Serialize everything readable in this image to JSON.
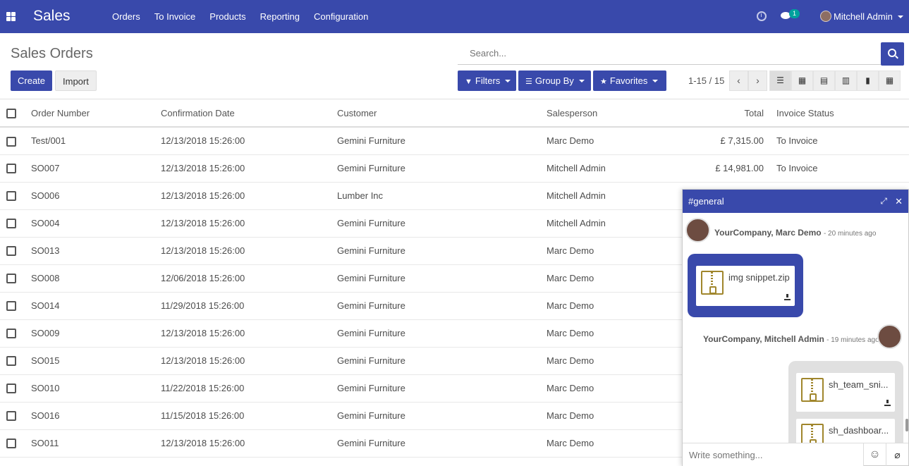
{
  "app": {
    "brand": "Sales",
    "menu": [
      "Orders",
      "To Invoice",
      "Products",
      "Reporting",
      "Configuration"
    ],
    "chat_badge": "1",
    "user_name": "Mitchell Admin"
  },
  "control_panel": {
    "title": "Sales Orders",
    "create_label": "Create",
    "import_label": "Import",
    "search_placeholder": "Search...",
    "filters_label": "Filters",
    "groupby_label": "Group By",
    "favorites_label": "Favorites",
    "pager": "1-15 / 15"
  },
  "table": {
    "headers": [
      "Order Number",
      "Confirmation Date",
      "Customer",
      "Salesperson",
      "Total",
      "Invoice Status"
    ],
    "rows": [
      [
        "Test/001",
        "12/13/2018 15:26:00",
        "Gemini Furniture",
        "Marc Demo",
        "£ 7,315.00",
        "To Invoice"
      ],
      [
        "SO007",
        "12/13/2018 15:26:00",
        "Gemini Furniture",
        "Mitchell Admin",
        "£ 14,981.00",
        "To Invoice"
      ],
      [
        "SO006",
        "12/13/2018 15:26:00",
        "Lumber Inc",
        "Mitchell Admin",
        "",
        ""
      ],
      [
        "SO004",
        "12/13/2018 15:26:00",
        "Gemini Furniture",
        "Mitchell Admin",
        "",
        ""
      ],
      [
        "SO013",
        "12/13/2018 15:26:00",
        "Gemini Furniture",
        "Marc Demo",
        "",
        ""
      ],
      [
        "SO008",
        "12/06/2018 15:26:00",
        "Gemini Furniture",
        "Marc Demo",
        "",
        ""
      ],
      [
        "SO014",
        "11/29/2018 15:26:00",
        "Gemini Furniture",
        "Marc Demo",
        "",
        ""
      ],
      [
        "SO009",
        "12/13/2018 15:26:00",
        "Gemini Furniture",
        "Marc Demo",
        "",
        ""
      ],
      [
        "SO015",
        "12/13/2018 15:26:00",
        "Gemini Furniture",
        "Marc Demo",
        "",
        ""
      ],
      [
        "SO010",
        "11/22/2018 15:26:00",
        "Gemini Furniture",
        "Marc Demo",
        "",
        ""
      ],
      [
        "SO016",
        "11/15/2018 15:26:00",
        "Gemini Furniture",
        "Marc Demo",
        "",
        ""
      ],
      [
        "SO011",
        "12/13/2018 15:26:00",
        "Gemini Furniture",
        "Marc Demo",
        "",
        ""
      ]
    ]
  },
  "chat": {
    "channel": "#general",
    "messages": [
      {
        "author": "YourCompany, Marc Demo",
        "time": "- 20 minutes ago",
        "attachments": [
          "img snippet.zip"
        ]
      },
      {
        "author": "YourCompany, Mitchell Admin",
        "time": "- 19 minutes ago",
        "attachments": [
          "sh_team_sni...",
          "sh_dashboar..."
        ]
      }
    ],
    "compose_placeholder": "Write something..."
  },
  "colors": {
    "primary": "#3949ab",
    "zip": "#a0862c"
  }
}
